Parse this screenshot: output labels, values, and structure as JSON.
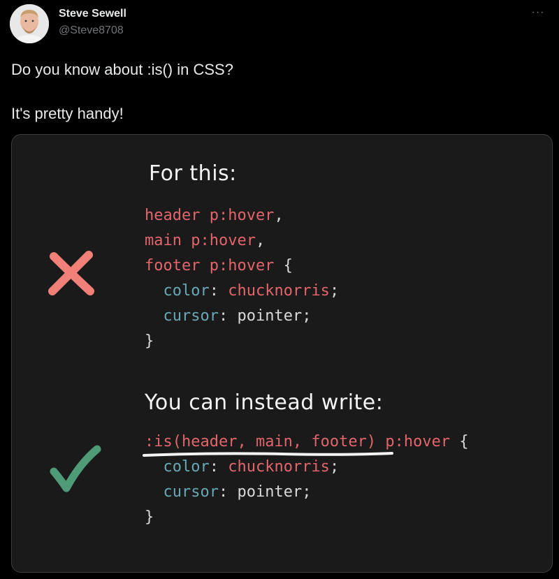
{
  "author": {
    "name": "Steve Sewell",
    "handle": "@Steve8708"
  },
  "more_menu_label": "···",
  "tweet": {
    "line1": "Do you know about :is() in CSS?",
    "line2": "It's pretty handy!"
  },
  "media": {
    "heading_before": "For this:",
    "heading_after": "You can instead write:",
    "before_code": {
      "sel1": "header p:hover",
      "sel2": "main p:hover",
      "sel3": "footer p:hover",
      "comma": ",",
      "brace_open": " {",
      "brace_close": "}",
      "prop1": "color",
      "val1": "chucknorris",
      "prop2": "cursor",
      "val2": "pointer",
      "colon": ":",
      "semi": ";"
    },
    "after_code": {
      "is_open": ":is(",
      "args": "header, main, footer",
      "is_close": ")",
      "rest": " p:hover",
      "brace_open": " {",
      "brace_close": "}",
      "prop1": "color",
      "val1": "chucknorris",
      "prop2": "cursor",
      "val2": "pointer",
      "colon": ":",
      "semi": ";"
    },
    "icons": {
      "bad": "cross-icon",
      "good": "check-icon"
    },
    "colors": {
      "selector": "#e2656c",
      "property": "#68a8b5",
      "cross": "#f08078",
      "check": "#4f9a77",
      "background": "#1a1a1b"
    }
  }
}
